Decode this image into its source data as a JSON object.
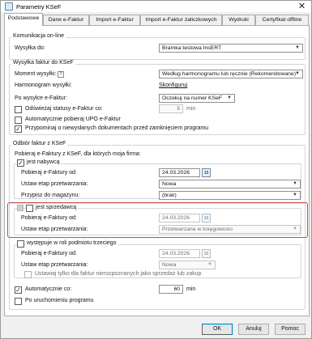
{
  "window": {
    "title": "Parametry KSeF",
    "close_glyph": "✕"
  },
  "tabs": [
    {
      "label": "Podstawowe",
      "active": true
    },
    {
      "label": "Dane e-Faktur",
      "active": false
    },
    {
      "label": "Import e-Faktur",
      "active": false
    },
    {
      "label": "Import e-Faktur zaliczkowych",
      "active": false
    },
    {
      "label": "Wydruki",
      "active": false
    },
    {
      "label": "Certyfikat offline",
      "active": false
    }
  ],
  "online": {
    "group_title": "Komunikacja on-line",
    "send_label": "Wysyłka do:",
    "send_value": "Bramka testowa InsERT"
  },
  "sending": {
    "group_title": "Wysyłka faktur do KSeF",
    "moment_label": "Moment wysyłki:",
    "moment_help": "?",
    "moment_value": "Według harmonogramu lub ręcznie (Rekomendowane)",
    "schedule_label": "Harmonogram wysyłki:",
    "schedule_link": "Skonfiguruj",
    "after_label": "Po wysyłce e-Faktur:",
    "after_value": "Oczekuj na numer KSeF",
    "refresh_label": "Odświeżaj statusy e-Faktur co:",
    "refresh_value": "5",
    "refresh_unit": "min",
    "auto_upo_label": "Automatycznie pobieraj UPO e-Faktur",
    "remind_label": "Przypominaj o niewysłanych dokumentach przed zamknięciem programu"
  },
  "receive": {
    "group_title": "Odbiór faktur z KSeF",
    "intro": "Pobieraj e-Faktury z KSeF, dla których moja firma:",
    "buyer": {
      "title": "jest nabywcą",
      "fetch_from_label": "Pobieraj e-Faktury od:",
      "fetch_from_value": "24.03.2026",
      "stage_label": "Ustaw etap przetwarzania:",
      "stage_value": "Nowa",
      "warehouse_label": "Przypisz do magazynu:",
      "warehouse_value": "(brak)"
    },
    "seller": {
      "title": "jest sprzedawcą",
      "help": "?",
      "fetch_from_label": "Pobieraj e-Faktury od:",
      "fetch_from_value": "24.03.2026",
      "stage_label": "Ustaw etap przetwarzania:",
      "stage_value": "Przetwarzana w księgowości"
    },
    "third": {
      "title": "występuje w roli podmiotu trzeciego",
      "fetch_from_label": "Pobieraj e-Faktury od:",
      "fetch_from_value": "24.03.2026",
      "stage_label": "Ustaw etap przetwarzania:",
      "stage_value": "Nowa",
      "only_unrecognized_label": "Ustawiaj tylko dla faktur nierozpoznanych jako sprzedaż lub zakup"
    },
    "auto_label": "Automatycznie co:",
    "auto_value": "60",
    "auto_unit": "min",
    "on_start_label": "Po uruchomieniu programu"
  },
  "buttons": {
    "ok": "OK",
    "cancel": "Anuluj",
    "help": "Pomoc"
  },
  "calendar_glyph": "15",
  "colors": {
    "highlight_border": "#d64545",
    "accent": "#0078d7"
  }
}
